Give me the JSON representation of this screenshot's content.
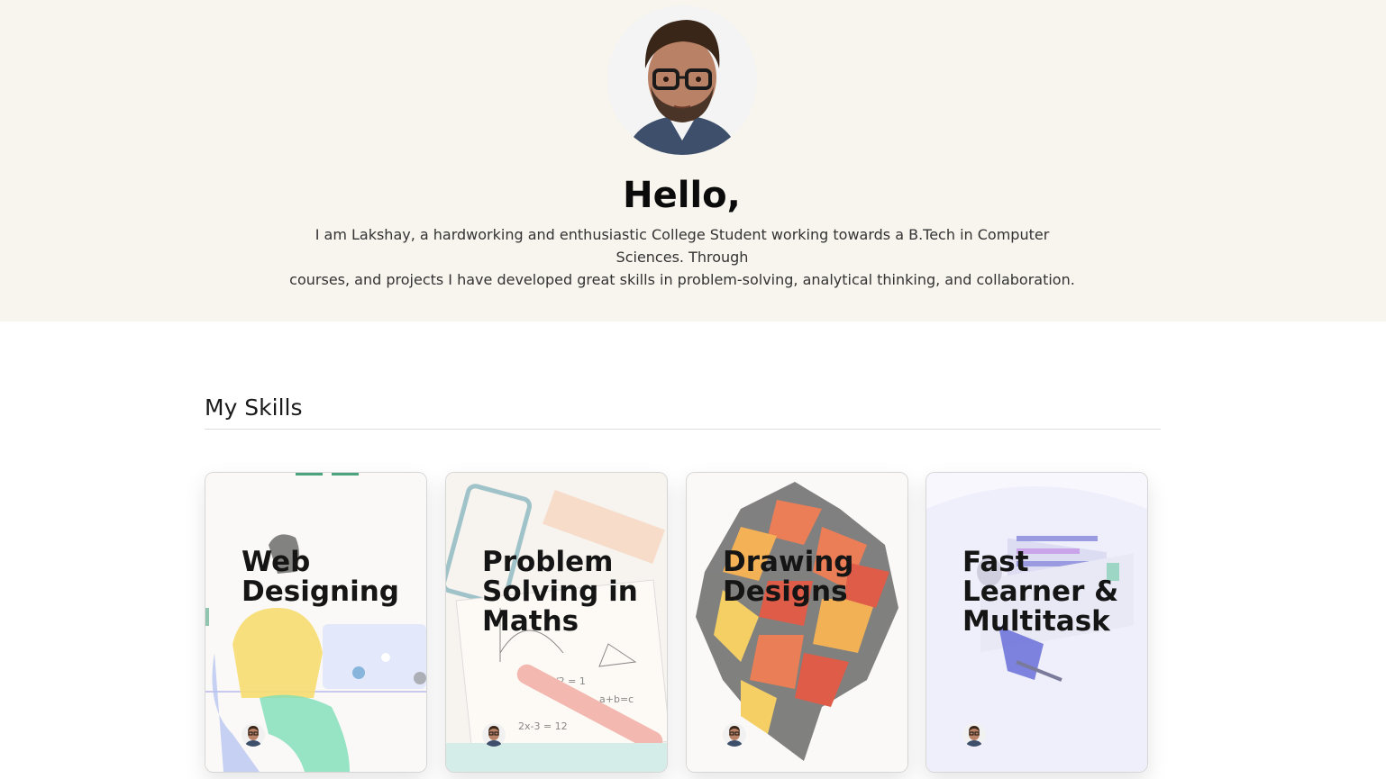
{
  "hero": {
    "greeting": "Hello,",
    "intro_line1": "I am Lakshay, a hardworking and enthusiastic College Student working towards a B.Tech in Computer Sciences. Through",
    "intro_line2": "courses, and projects I have developed great skills in problem-solving, analytical thinking, and collaboration."
  },
  "skills": {
    "heading": "My Skills",
    "cards": [
      {
        "line1": "Web",
        "line2": "Designing",
        "line3": "",
        "image": "developer-at-laptop-illustration"
      },
      {
        "line1": "Problem",
        "line2": "Solving in",
        "line3": "Maths",
        "image": "math-tools-illustration"
      },
      {
        "line1": "Drawing",
        "line2": "Designs",
        "line3": "",
        "image": "geometric-lion-illustration"
      },
      {
        "line1": "Fast",
        "line2": "Learner &",
        "line3": "Multitask",
        "image": "workspace-illustration"
      }
    ]
  },
  "colors": {
    "hero_bg": "#f8f4ee",
    "page_bg": "#ffffff",
    "text": "#111111"
  }
}
